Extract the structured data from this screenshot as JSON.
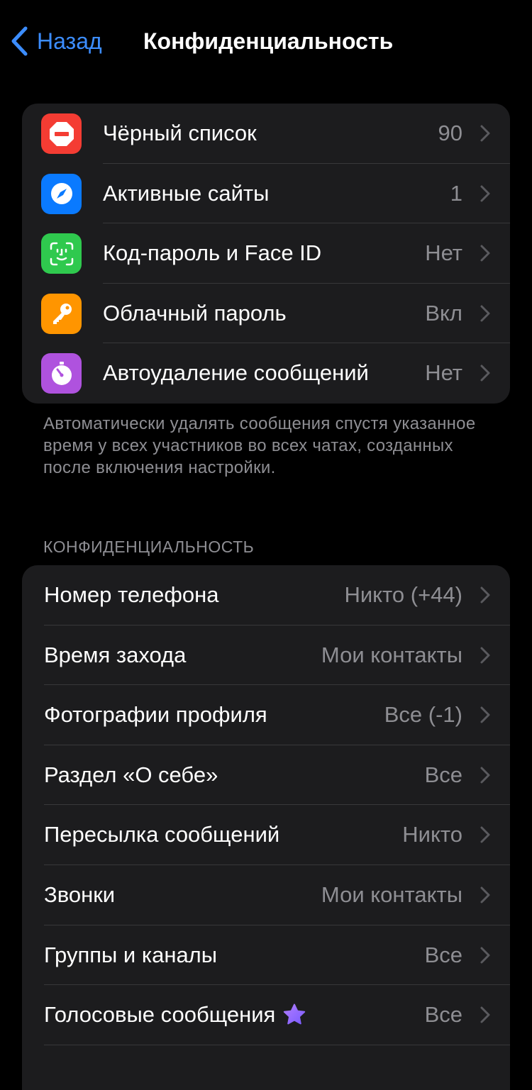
{
  "nav": {
    "back_label": "Назад",
    "title": "Конфиденциальность"
  },
  "security": {
    "items": [
      {
        "label": "Чёрный список",
        "value": "90",
        "icon": "blocked-icon",
        "color": "#f43c33"
      },
      {
        "label": "Активные сайты",
        "value": "1",
        "icon": "compass-icon",
        "color": "#0a7aff"
      },
      {
        "label": "Код-пароль и Face ID",
        "value": "Нет",
        "icon": "faceid-icon",
        "color": "#2fc94e"
      },
      {
        "label": "Облачный пароль",
        "value": "Вкл",
        "icon": "key-icon",
        "color": "#ff9500"
      },
      {
        "label": "Автоудаление сообщений",
        "value": "Нет",
        "icon": "timer-icon",
        "color": "#af52de"
      }
    ],
    "footer": "Автоматически удалять сообщения спустя указанное время у всех участников во всех чатах, созданных после включения настройки."
  },
  "privacy": {
    "header": "КОНФИДЕНЦИАЛЬНОСТЬ",
    "items": [
      {
        "label": "Номер телефона",
        "value": "Никто (+44)"
      },
      {
        "label": "Время захода",
        "value": "Мои контакты"
      },
      {
        "label": "Фотографии профиля",
        "value": "Все (-1)"
      },
      {
        "label": "Раздел «О себе»",
        "value": "Все"
      },
      {
        "label": "Пересылка сообщений",
        "value": "Никто"
      },
      {
        "label": "Звонки",
        "value": "Мои контакты"
      },
      {
        "label": "Группы и каналы",
        "value": "Все"
      },
      {
        "label": "Голосовые сообщения",
        "value": "Все",
        "badge": "premium-star-icon"
      }
    ]
  },
  "colors": {
    "accent": "#3c8dff",
    "background": "#000000",
    "cell": "#1c1c1e",
    "secondary_text": "#8e8e93",
    "premium_star": "#9b6bff"
  }
}
